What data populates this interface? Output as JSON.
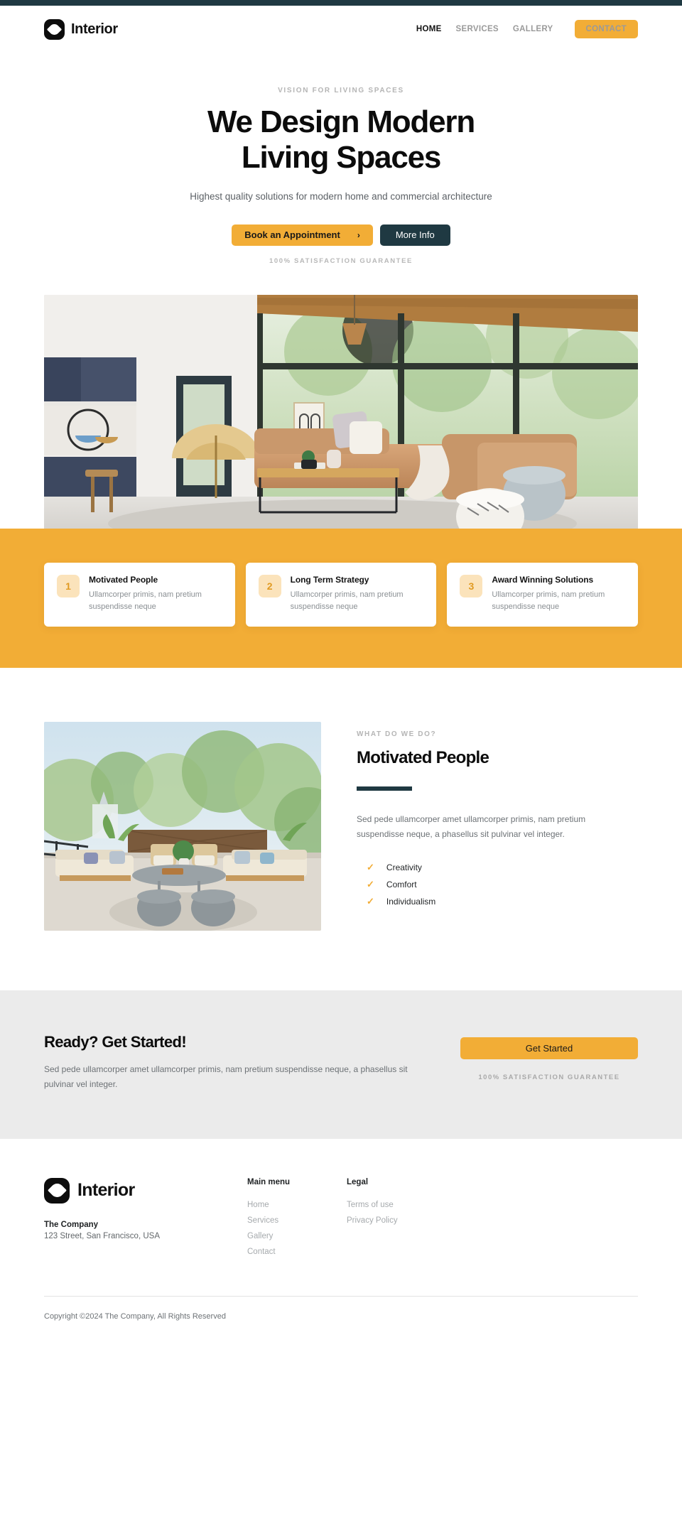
{
  "theme": {
    "accent": "#f2ad36",
    "dark": "#1f3942",
    "muted": "#9a9a9a",
    "band_bg": "#ebebeb"
  },
  "header": {
    "brand": "Interior",
    "logo_icon": "interior-diamond-logo",
    "nav": [
      {
        "label": "HOME",
        "active": true
      },
      {
        "label": "SERVICES",
        "active": false
      },
      {
        "label": "GALLERY",
        "active": false
      }
    ],
    "contact_button": "CONTACT"
  },
  "hero": {
    "eyebrow": "VISION FOR LIVING SPACES",
    "title_line1": "We Design Modern",
    "title_line2": "Living Spaces",
    "subtitle": "Highest quality solutions for modern home and commercial architecture",
    "primary_button": "Book an Appointment",
    "primary_button_icon": "chevron-right-icon",
    "primary_button_chevron": "›",
    "secondary_button": "More Info",
    "guarantee": "100% SATISFACTION GUARANTEE",
    "image_alt": "modern-living-room-photo"
  },
  "features": [
    {
      "number": "1",
      "title": "Motivated People",
      "description": "Ullamcorper primis, nam pretium suspendisse neque"
    },
    {
      "number": "2",
      "title": "Long Term Strategy",
      "description": "Ullamcorper primis, nam pretium suspendisse neque"
    },
    {
      "number": "3",
      "title": "Award Winning Solutions",
      "description": "Ullamcorper primis, nam pretium suspendisse neque"
    }
  ],
  "about": {
    "image_alt": "outdoor-terrace-lounge-photo",
    "eyebrow": "WHAT DO WE DO?",
    "title": "Motivated People",
    "text": "Sed pede ullamcorper amet ullamcorper primis, nam pretium suspendisse neque, a phasellus sit pulvinar vel integer.",
    "checklist": [
      "Creativity",
      "Comfort",
      "Individualism"
    ],
    "check_glyph": "✓"
  },
  "cta": {
    "title": "Ready? Get Started!",
    "text": "Sed pede ullamcorper amet ullamcorper primis, nam pretium suspendisse neque, a phasellus sit pulvinar vel integer.",
    "button": "Get Started",
    "guarantee": "100% SATISFACTION GUARANTEE"
  },
  "footer": {
    "brand": "Interior",
    "logo_icon": "interior-diamond-logo",
    "company": "The Company",
    "address": "123 Street, San Francisco, USA",
    "columns": [
      {
        "title": "Main menu",
        "links": [
          "Home",
          "Services",
          "Gallery",
          "Contact"
        ]
      },
      {
        "title": "Legal",
        "links": [
          "Terms of use",
          "Privacy Policy"
        ]
      }
    ],
    "copyright": "Copyright ©2024 The Company, All Rights Reserved"
  }
}
